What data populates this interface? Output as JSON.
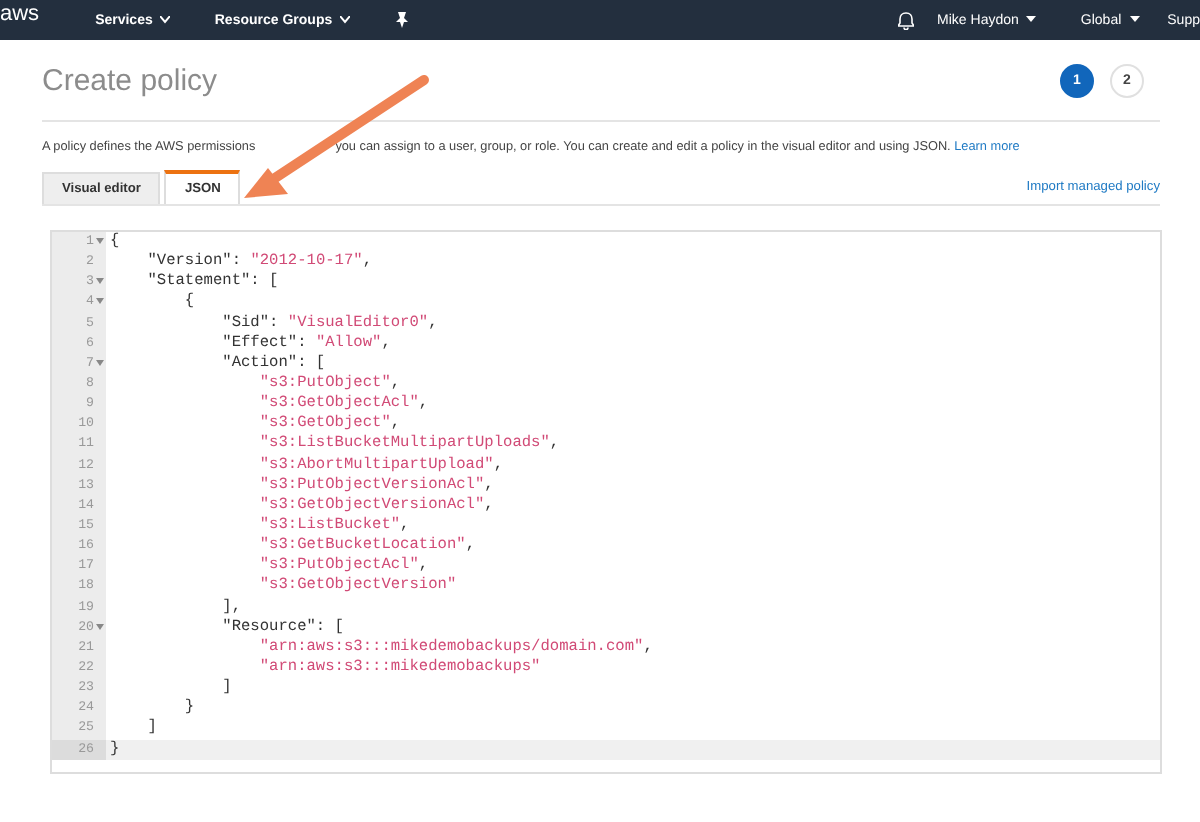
{
  "navbar": {
    "logo": "aws",
    "menus": [
      {
        "label": "Services"
      },
      {
        "label": "Resource Groups"
      }
    ],
    "user": "Mike Haydon",
    "region": "Global",
    "support": "Supp"
  },
  "header": {
    "title": "Create policy",
    "steps": [
      {
        "label": "1",
        "selected": true
      },
      {
        "label": "2",
        "selected": false
      }
    ]
  },
  "description": [
    "A policy defines the AWS permissions",
    "you can assign to a user, group, or role. You can create and edit a policy in the visual editor and using JSON."
  ],
  "learn_more": "Learn more",
  "tabs": [
    {
      "label": "Visual editor",
      "selected": false
    },
    {
      "label": "JSON",
      "selected": true
    }
  ],
  "import_link": "Import managed policy",
  "editor": {
    "lines": [
      {
        "number": "1",
        "fold": true,
        "active": false,
        "tokens": [
          {
            "kind": "punct",
            "text": "{"
          }
        ]
      },
      {
        "number": "2",
        "fold": false,
        "active": false,
        "tokens": [
          {
            "kind": "punct",
            "text": "    \"Version\": "
          },
          {
            "kind": "string",
            "text": "\"2012-10-17\""
          },
          {
            "kind": "punct",
            "text": ","
          }
        ]
      },
      {
        "number": "3",
        "fold": true,
        "active": false,
        "tokens": [
          {
            "kind": "punct",
            "text": "    \"Statement\": ["
          }
        ]
      },
      {
        "number": "4",
        "fold": true,
        "active": false,
        "tokens": [
          {
            "kind": "punct",
            "text": "        {"
          }
        ]
      },
      {
        "number": "5",
        "fold": false,
        "active": false,
        "tokens": [
          {
            "kind": "punct",
            "text": "            \"Sid\": "
          },
          {
            "kind": "string",
            "text": "\"VisualEditor0\""
          },
          {
            "kind": "punct",
            "text": ","
          }
        ]
      },
      {
        "number": "6",
        "fold": false,
        "active": false,
        "tokens": [
          {
            "kind": "punct",
            "text": "            \"Effect\": "
          },
          {
            "kind": "string",
            "text": "\"Allow\""
          },
          {
            "kind": "punct",
            "text": ","
          }
        ]
      },
      {
        "number": "7",
        "fold": true,
        "active": false,
        "tokens": [
          {
            "kind": "punct",
            "text": "            \"Action\": ["
          }
        ]
      },
      {
        "number": "8",
        "fold": false,
        "active": false,
        "tokens": [
          {
            "kind": "string",
            "text": "                \"s3:PutObject\""
          },
          {
            "kind": "punct",
            "text": ","
          }
        ]
      },
      {
        "number": "9",
        "fold": false,
        "active": false,
        "tokens": [
          {
            "kind": "string",
            "text": "                \"s3:GetObjectAcl\""
          },
          {
            "kind": "punct",
            "text": ","
          }
        ]
      },
      {
        "number": "10",
        "fold": false,
        "active": false,
        "tokens": [
          {
            "kind": "string",
            "text": "                \"s3:GetObject\""
          },
          {
            "kind": "punct",
            "text": ","
          }
        ]
      },
      {
        "number": "11",
        "fold": false,
        "active": false,
        "tokens": [
          {
            "kind": "string",
            "text": "                \"s3:ListBucketMultipartUploads\""
          },
          {
            "kind": "punct",
            "text": ","
          }
        ]
      },
      {
        "number": "12",
        "fold": false,
        "active": false,
        "tokens": [
          {
            "kind": "string",
            "text": "                \"s3:AbortMultipartUpload\""
          },
          {
            "kind": "punct",
            "text": ","
          }
        ]
      },
      {
        "number": "13",
        "fold": false,
        "active": false,
        "tokens": [
          {
            "kind": "string",
            "text": "                \"s3:PutObjectVersionAcl\""
          },
          {
            "kind": "punct",
            "text": ","
          }
        ]
      },
      {
        "number": "14",
        "fold": false,
        "active": false,
        "tokens": [
          {
            "kind": "string",
            "text": "                \"s3:GetObjectVersionAcl\""
          },
          {
            "kind": "punct",
            "text": ","
          }
        ]
      },
      {
        "number": "15",
        "fold": false,
        "active": false,
        "tokens": [
          {
            "kind": "string",
            "text": "                \"s3:ListBucket\""
          },
          {
            "kind": "punct",
            "text": ","
          }
        ]
      },
      {
        "number": "16",
        "fold": false,
        "active": false,
        "tokens": [
          {
            "kind": "string",
            "text": "                \"s3:GetBucketLocation\""
          },
          {
            "kind": "punct",
            "text": ","
          }
        ]
      },
      {
        "number": "17",
        "fold": false,
        "active": false,
        "tokens": [
          {
            "kind": "string",
            "text": "                \"s3:PutObjectAcl\""
          },
          {
            "kind": "punct",
            "text": ","
          }
        ]
      },
      {
        "number": "18",
        "fold": false,
        "active": false,
        "tokens": [
          {
            "kind": "string",
            "text": "                \"s3:GetObjectVersion\""
          }
        ]
      },
      {
        "number": "19",
        "fold": false,
        "active": false,
        "tokens": [
          {
            "kind": "punct",
            "text": "            ],"
          }
        ]
      },
      {
        "number": "20",
        "fold": true,
        "active": false,
        "tokens": [
          {
            "kind": "punct",
            "text": "            \"Resource\": ["
          }
        ]
      },
      {
        "number": "21",
        "fold": false,
        "active": false,
        "tokens": [
          {
            "kind": "string",
            "text": "                \"arn:aws:s3:::mikedemobackups/domain.com\""
          },
          {
            "kind": "punct",
            "text": ","
          }
        ]
      },
      {
        "number": "22",
        "fold": false,
        "active": false,
        "tokens": [
          {
            "kind": "string",
            "text": "                \"arn:aws:s3:::mikedemobackups\""
          }
        ]
      },
      {
        "number": "23",
        "fold": false,
        "active": false,
        "tokens": [
          {
            "kind": "punct",
            "text": "            ]"
          }
        ]
      },
      {
        "number": "24",
        "fold": false,
        "active": false,
        "tokens": [
          {
            "kind": "punct",
            "text": "        }"
          }
        ]
      },
      {
        "number": "25",
        "fold": false,
        "active": false,
        "tokens": [
          {
            "kind": "punct",
            "text": "    ]"
          }
        ]
      },
      {
        "number": "26",
        "fold": false,
        "active": true,
        "tokens": [
          {
            "kind": "punct",
            "text": "}"
          }
        ]
      }
    ]
  }
}
